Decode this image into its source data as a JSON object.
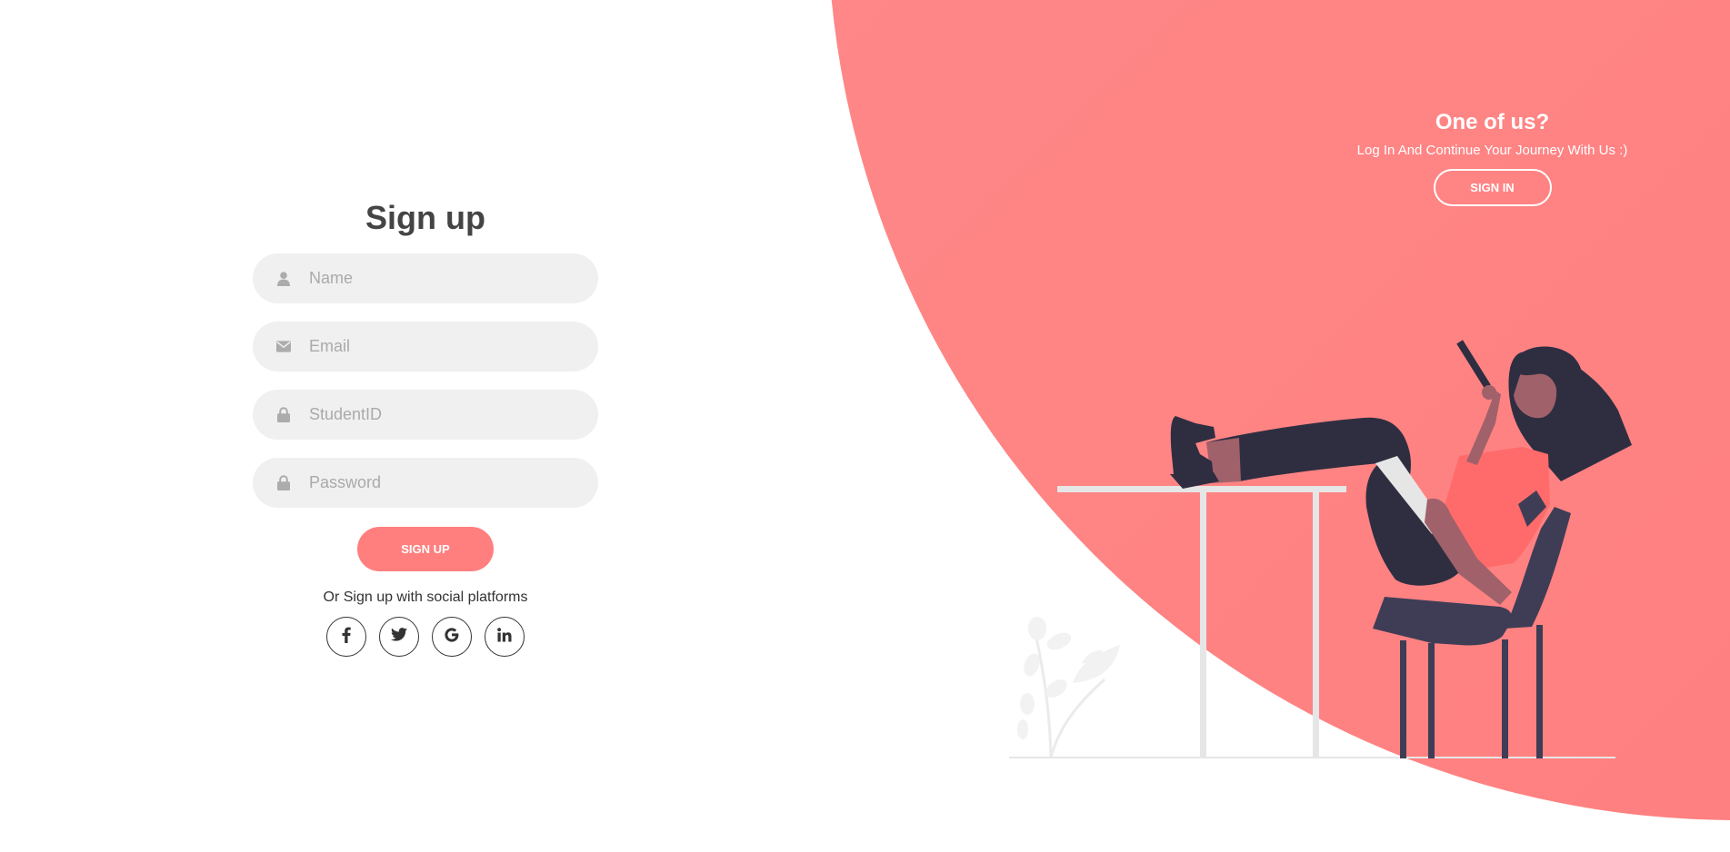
{
  "signup": {
    "title": "Sign up",
    "name_placeholder": "Name",
    "email_placeholder": "Email",
    "student_id_placeholder": "StudentID",
    "password_placeholder": "Password",
    "submit_label": "SIGN UP",
    "social_text": "Or Sign up with social platforms",
    "social_icons": [
      "facebook-icon",
      "twitter-icon",
      "google-icon",
      "linkedin-icon"
    ]
  },
  "panel": {
    "heading": "One of us?",
    "subtitle": "Log In And Continue Your Journey With Us :)",
    "signin_label": "SIGN IN"
  },
  "colors": {
    "accent": "#ff7f7f",
    "panel_bg": "#ff8585",
    "field_bg": "#f0f0f0",
    "title_text": "#444444",
    "placeholder_text": "#aaaaaa"
  },
  "icons": {
    "name_field": "user-icon",
    "email_field": "envelope-icon",
    "student_id_field": "lock-icon",
    "password_field": "lock-icon"
  }
}
